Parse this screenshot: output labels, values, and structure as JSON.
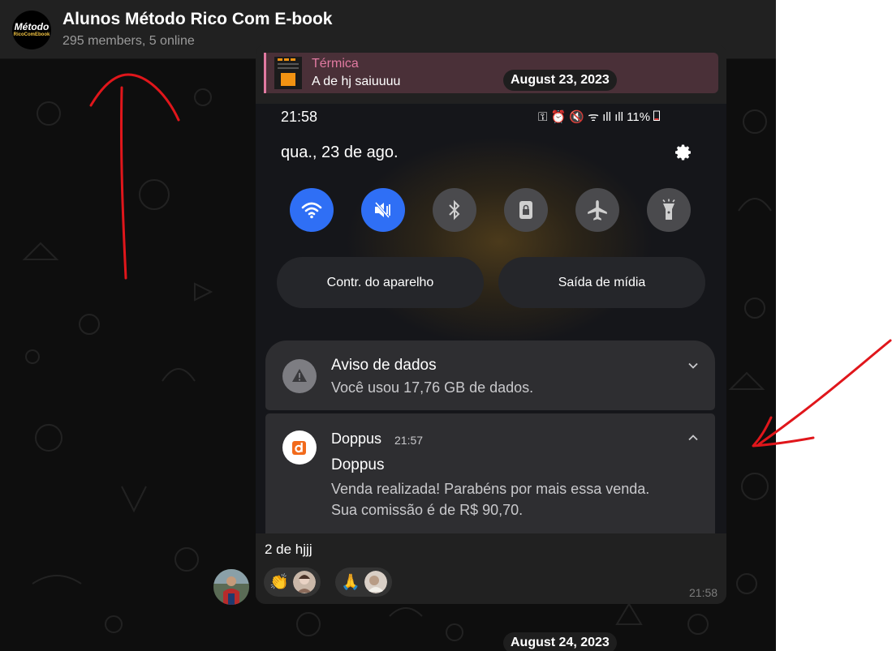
{
  "header": {
    "logo_line1": "Método",
    "logo_line2": "RicoComEbook",
    "title": "Alunos Método Rico Com E-book",
    "subtitle": "295 members, 5 online"
  },
  "message": {
    "reply": {
      "name": "Térmica",
      "text": "A de hj saiuuuu"
    },
    "date_pill": "August 23, 2023",
    "caption": "2 de hjjj",
    "time": "21:58",
    "reactions": [
      {
        "emoji": "👏",
        "icon": "clapping-hands-emoji"
      },
      {
        "emoji": "🙏",
        "icon": "folded-hands-emoji"
      }
    ]
  },
  "phone": {
    "time": "21:58",
    "status": "11%",
    "date": "qua., 23 de ago.",
    "quick_settings": [
      {
        "icon": "wifi-icon",
        "on": true
      },
      {
        "icon": "mute-icon",
        "on": true
      },
      {
        "icon": "bluetooth-icon",
        "on": false
      },
      {
        "icon": "rotation-lock-icon",
        "on": false
      },
      {
        "icon": "airplane-icon",
        "on": false
      },
      {
        "icon": "flashlight-icon",
        "on": false
      }
    ],
    "buttons": {
      "device_control": "Contr. do aparelho",
      "media_output": "Saída de mídia"
    },
    "notifications": [
      {
        "title": "Aviso de dados",
        "body": "Você usou 17,76 GB de dados."
      },
      {
        "app": "Doppus",
        "time": "21:57",
        "title": "Doppus",
        "body_line1": "Venda realizada! Parabéns por mais essa venda.",
        "body_line2": "Sua comissão é de R$ 90,70."
      }
    ]
  },
  "next_date_pill": "August 24, 2023",
  "colors": {
    "accent_blue": "#2f6ff5",
    "reply_pink": "#e27aa2",
    "annotation_red": "#e0161b"
  }
}
